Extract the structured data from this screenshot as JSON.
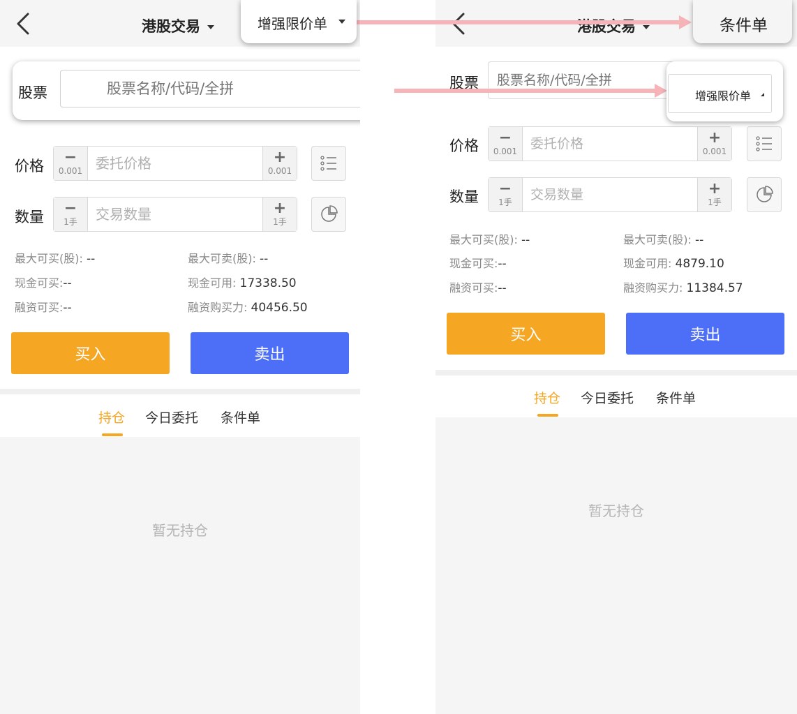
{
  "left": {
    "nav": {
      "title": "港股交易",
      "order_type": "增强限价单"
    },
    "stock": {
      "label": "股票",
      "placeholder": "股票名称/代码/全拼"
    },
    "price": {
      "label": "价格",
      "placeholder": "委托价格",
      "minus_step": "0.001",
      "plus_step": "0.001"
    },
    "quantity": {
      "label": "数量",
      "placeholder": "交易数量",
      "minus_step": "1手",
      "plus_step": "1手"
    },
    "info": {
      "max_buy_label": "最大可买(股):",
      "max_buy_value": "--",
      "max_sell_label": "最大可卖(股):",
      "max_sell_value": "--",
      "cash_buy_label": "现金可买:",
      "cash_buy_value": "--",
      "cash_avail_label": "现金可用:",
      "cash_avail_value": "17338.50",
      "margin_buy_label": "融资可买:",
      "margin_buy_value": "--",
      "margin_power_label": "融资购买力:",
      "margin_power_value": "40456.50"
    },
    "buttons": {
      "buy": "买入",
      "sell": "卖出"
    },
    "tabs": [
      "持仓",
      "今日委托",
      "条件单"
    ],
    "empty_text": "暂无持仓"
  },
  "right": {
    "nav": {
      "title": "港股交易",
      "order_type": "条件单"
    },
    "stock": {
      "label": "股票",
      "placeholder": "股票名称/代码/全拼",
      "order_select": "增强限价单"
    },
    "price": {
      "label": "价格",
      "placeholder": "委托价格",
      "minus_step": "0.001",
      "plus_step": "0.001"
    },
    "quantity": {
      "label": "数量",
      "placeholder": "交易数量",
      "minus_step": "1手",
      "plus_step": "1手"
    },
    "info": {
      "max_buy_label": "最大可买(股):",
      "max_buy_value": "--",
      "max_sell_label": "最大可卖(股):",
      "max_sell_value": "--",
      "cash_buy_label": "现金可买:",
      "cash_buy_value": "--",
      "cash_avail_label": "现金可用:",
      "cash_avail_value": "4879.10",
      "margin_buy_label": "融资可买:",
      "margin_buy_value": "--",
      "margin_power_label": "融资购买力:",
      "margin_power_value": "11384.57"
    },
    "buttons": {
      "buy": "买入",
      "sell": "卖出"
    },
    "tabs": [
      "持仓",
      "今日委托",
      "条件单"
    ],
    "empty_text": "暂无持仓"
  },
  "colors": {
    "buy": "#f5a623",
    "sell": "#4d6ef7",
    "active_tab": "#f5a623",
    "arrow": "#f7b4b8"
  }
}
